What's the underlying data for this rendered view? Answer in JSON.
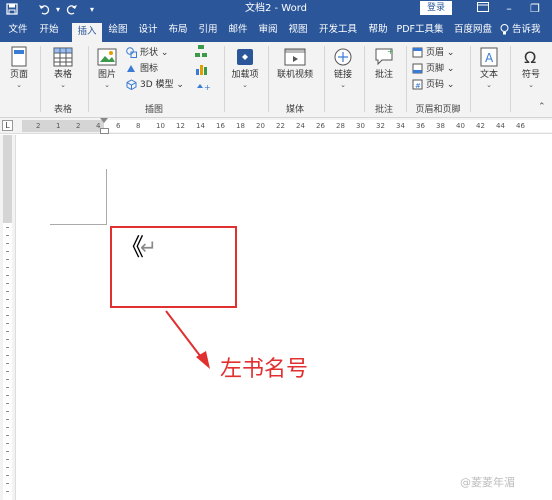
{
  "titlebar": {
    "title": "文档2 - Word",
    "login": "登录",
    "save_icon": "save-icon",
    "undo_icon": "undo-icon",
    "redo_icon": "redo-icon",
    "qa_icon": "customize-quick-access-icon"
  },
  "menu": {
    "tabs": [
      "文件",
      "开始",
      "插入",
      "绘图",
      "设计",
      "布局",
      "引用",
      "邮件",
      "审阅",
      "视图",
      "开发工具",
      "帮助",
      "PDF工具集",
      "百度网盘"
    ],
    "active": "插入",
    "tell_me": "告诉我"
  },
  "ribbon": {
    "page": "页面",
    "table": "表格",
    "picture": "图片",
    "shape": "形状",
    "icon": "图标",
    "model3d": "3D 模型",
    "addins": "加载项",
    "online_video": "联机视频",
    "link": "链接",
    "comment": "批注",
    "header": "页眉",
    "footer": "页脚",
    "page_number": "页码",
    "textbox": "文本",
    "symbol": "符号",
    "groups": {
      "table": "表格",
      "illustrations": "插图",
      "media": "媒体",
      "comments": "批注",
      "header_footer": "页眉和页脚"
    }
  },
  "ruler": {
    "numbers": [
      "2",
      "1",
      "2",
      "4",
      "6",
      "8",
      "10",
      "12",
      "14",
      "16",
      "18",
      "20",
      "22",
      "24",
      "26",
      "28",
      "30",
      "32",
      "34",
      "36",
      "38",
      "40",
      "42",
      "44",
      "46"
    ]
  },
  "document": {
    "content": "《",
    "paragraph_mark": "↵",
    "annotation": "左书名号",
    "watermark": "@菱菱年湄"
  },
  "colors": {
    "brand": "#2b579a",
    "annotation": "#e03030"
  }
}
